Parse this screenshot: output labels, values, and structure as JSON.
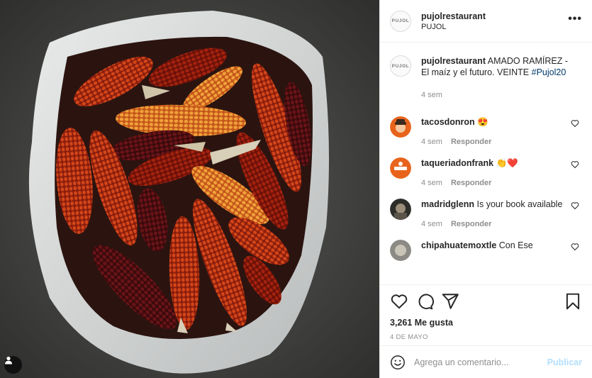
{
  "post": {
    "username": "pujolrestaurant",
    "location": "PUJOL",
    "avatar_text": "PUJOL",
    "more_label": "•••"
  },
  "caption": {
    "username": "pujolrestaurant",
    "text": "AMADO RAMÍREZ - El maíz y el futuro. VEINTE",
    "hashtag": "#Pujol20",
    "age": "4 sem"
  },
  "comments": [
    {
      "username": "tacosdonron",
      "text": "😍",
      "age": "4 sem",
      "reply": "Responder"
    },
    {
      "username": "taqueriadonfrank",
      "text": "👏❤️",
      "age": "4 sem",
      "reply": "Responder"
    },
    {
      "username": "madridglenn",
      "text": "Is your book available",
      "age": "4 sem",
      "reply": "Responder"
    },
    {
      "username": "chipahuatemoxtle",
      "text": "Con Ese",
      "age": "",
      "reply": ""
    }
  ],
  "stats": {
    "likes": "3,261 Me gusta",
    "date": "4 DE MAYO"
  },
  "composer": {
    "placeholder": "Agrega un comentario...",
    "post_label": "Publicar"
  },
  "icons": {
    "like": "heart-icon",
    "comment": "comment-icon",
    "share": "paper-plane-icon",
    "save": "bookmark-icon",
    "emoji": "emoji-icon",
    "tag": "user-tag-icon"
  },
  "colors": {
    "hashtag": "#00376b",
    "post_disabled": "#b2dffc",
    "muted": "#8e8e8e"
  }
}
